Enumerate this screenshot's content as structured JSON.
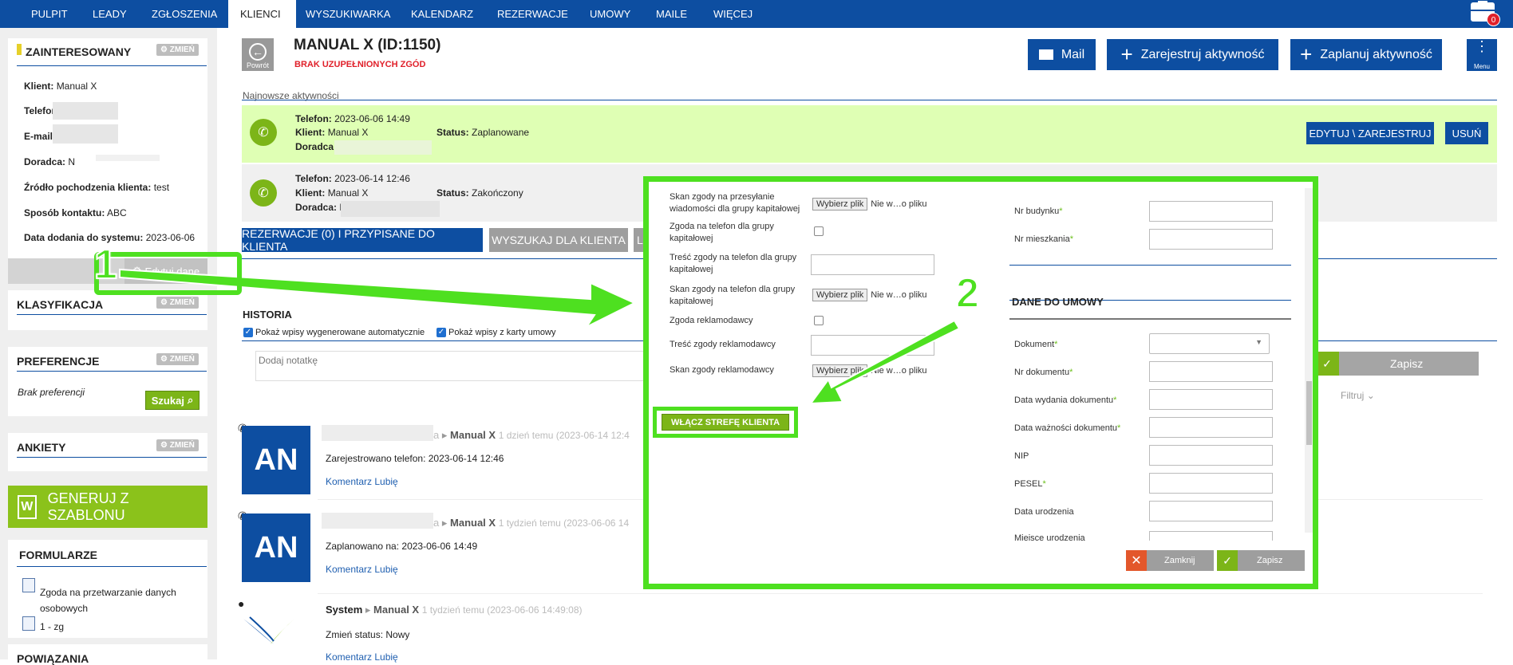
{
  "nav": {
    "items": [
      "PULPIT",
      "LEADY",
      "ZGŁOSZENIA",
      "KLIENCI",
      "WYSZUKIWARKA",
      "KALENDARZ",
      "REZERWACJE",
      "UMOWY",
      "MAILE",
      "WIĘCEJ"
    ],
    "active": "KLIENCI",
    "notification_count": "0"
  },
  "sidebar": {
    "status_title": "ZAINTERESOWANY",
    "change_label": "ZMIEŃ",
    "client_label": "Klient:",
    "client_value": "Manual X",
    "phone_label": "Telefon:",
    "email_label": "E-mail:",
    "email_value": "›",
    "advisor_label": "Doradca:",
    "advisor_value": "N",
    "source_label": "Źródło pochodzenia klienta:",
    "source_value": "test",
    "contact_label": "Sposób kontaktu:",
    "contact_value": "ABC",
    "added_label": "Data dodania do systemu:",
    "added_value": "2023-06-06",
    "edit_label": "Edytuj dane",
    "classification_title": "KLASYFIKACJA",
    "preferences_title": "PREFERENCJE",
    "no_preferences": "Brak preferencji",
    "search_label": "Szukaj",
    "surveys_title": "ANKIETY",
    "generate_label": "GENERUJ Z SZABLONU",
    "forms_title": "FORMULARZE",
    "forms": [
      "Zgoda na przetwarzanie danych osobowych",
      "1 - zg"
    ],
    "relations_title": "POWIĄZANIA"
  },
  "header": {
    "back_label": "Powrót",
    "title": "MANUAL X (ID:1150)",
    "warning": "BRAK UZUPEŁNIONYCH ZGÓD",
    "mail_label": "Mail",
    "register_label": "Zarejestruj aktywność",
    "plan_label": "Zaplanuj aktywność",
    "menu_label": "Menu"
  },
  "activities": {
    "section_label": "Najnowsze aktywności",
    "items": [
      {
        "phone_label": "Telefon:",
        "date": "2023-06-06 14:49",
        "client_label": "Klient:",
        "client": "Manual X",
        "advisor_label": "Doradca:",
        "status_label": "Status:",
        "status": "Zaplanowane",
        "edit_label": "EDYTUJ \\ ZAREJESTRUJ",
        "delete_label": "USUŃ"
      },
      {
        "phone_label": "Telefon:",
        "date": "2023-06-14 12:46",
        "client_label": "Klient:",
        "client": "Manual X",
        "advisor_label": "Doradca:",
        "advisor_value": "N",
        "status_label": "Status:",
        "status": "Zakończony"
      }
    ]
  },
  "tabs": {
    "reservations": "REZERWACJE (0) I PRZYPISANE DO KLIENTA",
    "search_for_client": "WYSZUKAJ DLA KLIENTA",
    "third": "L"
  },
  "history": {
    "title": "HISTORIA",
    "auto_label": "Pokaż wpisy wygenerowane automatycznie",
    "contract_label": "Pokaż wpisy z karty umowy",
    "note_placeholder": "Dodaj notatkę",
    "save_label": "Zapisz",
    "filter_label": "Filtruj",
    "entries": [
      {
        "avatar": "AN",
        "name_tail": "a",
        "client": "Manual X",
        "time": "1 dzień temu (2023-06-14 12:4",
        "text": "Zarejestrowano telefon: 2023-06-14 12:46",
        "actions": "Komentarz Lubię"
      },
      {
        "avatar": "AN",
        "name_tail": "a",
        "client": "Manual X",
        "time": "1 tydzień temu (2023-06-06 14",
        "text": "Zaplanowano na: 2023-06-06 14:49",
        "actions": "Komentarz Lubię"
      },
      {
        "author": "System",
        "client": "Manual X",
        "time": "1 tydzień temu (2023-06-06 14:49:08)",
        "text": "Zmień status: Nowy",
        "actions": "Komentarz Lubię"
      }
    ]
  },
  "modal": {
    "left": {
      "skan_grupy_msg": "Skan zgody na przesyłanie wiadomości dla grupy kapitałowej",
      "zgoda_tel_grupy": "Zgoda na telefon dla grupy kapitałowej",
      "tresc_tel_grupy": "Treść zgody na telefon dla grupy kapitałowej",
      "skan_tel_grupy": "Skan zgody na telefon dla grupy kapitałowej",
      "zgoda_reklam": "Zgoda reklamodawcy",
      "tresc_reklam": "Treść zgody reklamodawcy",
      "skan_reklam": "Skan zgody reklamodawcy",
      "file_button": "Wybierz plik",
      "no_file": "Nie w…o pliku",
      "enable_zone": "WŁĄCZ STREFĘ KLIENTA"
    },
    "right": {
      "nr_budynku": "Nr budynku",
      "nr_mieszkania": "Nr mieszkania",
      "section_title": "DANE DO UMOWY",
      "dokument": "Dokument",
      "nr_dokumentu": "Nr dokumentu",
      "data_wydania": "Data wydania dokumentu",
      "data_waznosci": "Data ważności dokumentu",
      "nip": "NIP",
      "pesel": "PESEL",
      "data_urodzenia": "Data urodzenia",
      "miejsce_urodzenia": "Miejsce urodzenia",
      "required_mark": "*"
    },
    "close_label": "Zamknij",
    "save_label": "Zapisz"
  },
  "annotations": {
    "step1": "1",
    "step2": "2",
    "accent": "#4ee020"
  }
}
